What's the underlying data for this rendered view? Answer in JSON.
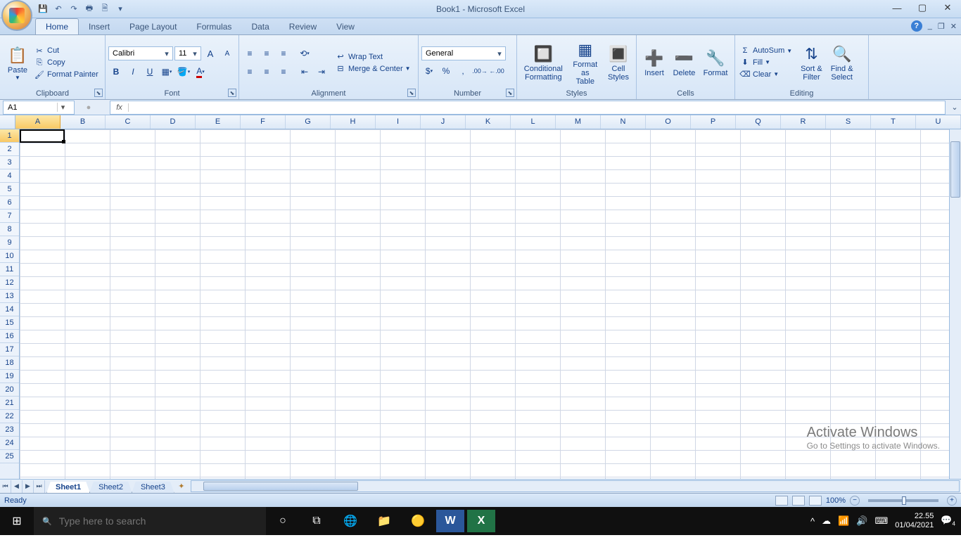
{
  "title": "Book1 - Microsoft Excel",
  "qat": {
    "save": "💾",
    "undo": "↶",
    "redo": "↷",
    "print": "🖶",
    "preview": "🗎"
  },
  "tabs": [
    "Home",
    "Insert",
    "Page Layout",
    "Formulas",
    "Data",
    "Review",
    "View"
  ],
  "active_tab": "Home",
  "ribbon": {
    "clipboard": {
      "label": "Clipboard",
      "paste": "Paste",
      "cut": "Cut",
      "copy": "Copy",
      "format_painter": "Format Painter"
    },
    "font": {
      "label": "Font",
      "name": "Calibri",
      "size": "11"
    },
    "alignment": {
      "label": "Alignment",
      "wrap": "Wrap Text",
      "merge": "Merge & Center"
    },
    "number": {
      "label": "Number",
      "format": "General"
    },
    "styles": {
      "label": "Styles",
      "cond": "Conditional\nFormatting",
      "table": "Format\nas Table",
      "cell": "Cell\nStyles"
    },
    "cells": {
      "label": "Cells",
      "insert": "Insert",
      "delete": "Delete",
      "format": "Format"
    },
    "editing": {
      "label": "Editing",
      "autosum": "AutoSum",
      "fill": "Fill",
      "clear": "Clear",
      "sort": "Sort &\nFilter",
      "find": "Find &\nSelect"
    }
  },
  "namebox": "A1",
  "formula": "",
  "columns": [
    "A",
    "B",
    "C",
    "D",
    "E",
    "F",
    "G",
    "H",
    "I",
    "J",
    "K",
    "L",
    "M",
    "N",
    "O",
    "P",
    "Q",
    "R",
    "S",
    "T",
    "U"
  ],
  "active_col": "A",
  "rows": [
    1,
    2,
    3,
    4,
    5,
    6,
    7,
    8,
    9,
    10,
    11,
    12,
    13,
    14,
    15,
    16,
    17,
    18,
    19,
    20,
    21,
    22,
    23,
    24,
    25
  ],
  "active_row": 1,
  "sheets": [
    "Sheet1",
    "Sheet2",
    "Sheet3"
  ],
  "active_sheet": "Sheet1",
  "status": "Ready",
  "zoom": "100%",
  "watermark": {
    "l1": "Activate Windows",
    "l2": "Go to Settings to activate Windows."
  },
  "taskbar": {
    "search_placeholder": "Type here to search",
    "time": "22.55",
    "date": "01/04/2021",
    "notif": "4"
  }
}
